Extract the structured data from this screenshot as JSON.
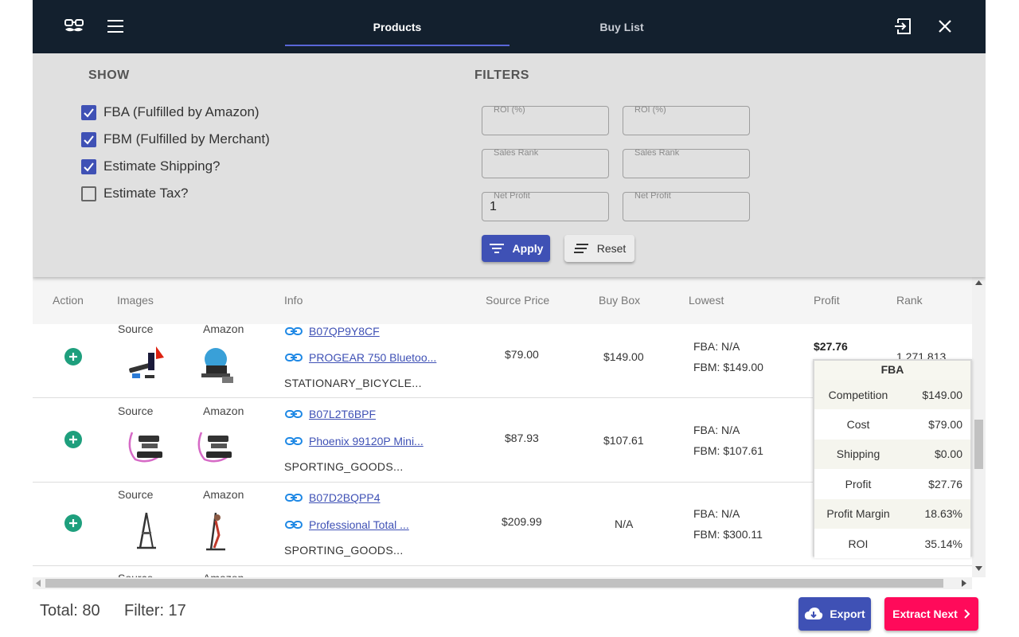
{
  "header": {
    "tabs": [
      {
        "label": "Products",
        "active": true
      },
      {
        "label": "Buy List",
        "active": false
      }
    ]
  },
  "show": {
    "title": "SHOW",
    "options": [
      {
        "label": "FBA (Fulfilled by Amazon)",
        "checked": true
      },
      {
        "label": "FBM (Fulfilled by Merchant)",
        "checked": true
      },
      {
        "label": "Estimate Shipping?",
        "checked": true
      },
      {
        "label": "Estimate Tax?",
        "checked": false
      }
    ]
  },
  "filters": {
    "title": "FILTERS",
    "fields": [
      {
        "label": "ROI (%)",
        "value": ""
      },
      {
        "label": "ROI (%)",
        "value": ""
      },
      {
        "label": "Sales Rank",
        "value": ""
      },
      {
        "label": "Sales Rank",
        "value": ""
      },
      {
        "label": "Net Profit",
        "value": "1"
      },
      {
        "label": "Net Profit",
        "value": ""
      }
    ],
    "apply_label": "Apply",
    "reset_label": "Reset"
  },
  "table": {
    "columns": [
      "Action",
      "Images",
      "Info",
      "Source Price",
      "Buy Box",
      "Lowest",
      "Profit",
      "Rank"
    ],
    "image_captions": {
      "source": "Source",
      "amazon": "Amazon"
    },
    "rows": [
      {
        "asin": "B07QP9Y8CF",
        "title": "PROGEAR 750 Bluetoo...",
        "category": "STATIONARY_BICYCLE...",
        "source_price": "$79.00",
        "buy_box": "$149.00",
        "fba": "FBA: N/A",
        "fbm": "FBM: $149.00",
        "profit": "$27.76",
        "rank": "1,271,813"
      },
      {
        "asin": "B07L2T6BPF",
        "title": "Phoenix 99120P Mini...",
        "category": "SPORTING_GOODS...",
        "source_price": "$87.93",
        "buy_box": "$107.61",
        "fba": "FBA: N/A",
        "fbm": "FBM: $107.61",
        "profit": "",
        "rank": ""
      },
      {
        "asin": "B07D2BQPP4",
        "title": "Professional Total ...",
        "category": "SPORTING_GOODS...",
        "source_price": "$209.99",
        "buy_box": "N/A",
        "fba": "FBA: N/A",
        "fbm": "FBM: $300.11",
        "profit": "",
        "rank": ""
      }
    ]
  },
  "popover": {
    "title": "FBA",
    "rows": [
      {
        "k": "Competition",
        "v": "$149.00"
      },
      {
        "k": "Cost",
        "v": "$79.00"
      },
      {
        "k": "Shipping",
        "v": "$0.00"
      },
      {
        "k": "Profit",
        "v": "$27.76"
      },
      {
        "k": "Profit Margin",
        "v": "18.63%"
      },
      {
        "k": "ROI",
        "v": "35.14%"
      }
    ]
  },
  "footer": {
    "total": "Total: 80",
    "filter": "Filter: 17",
    "export_label": "Export",
    "extract_label": "Extract Next"
  },
  "colors": {
    "header_bg": "#13202e",
    "primary": "#3f51b5",
    "accent": "#ff0a5a",
    "add_green": "#1e9f7d"
  }
}
